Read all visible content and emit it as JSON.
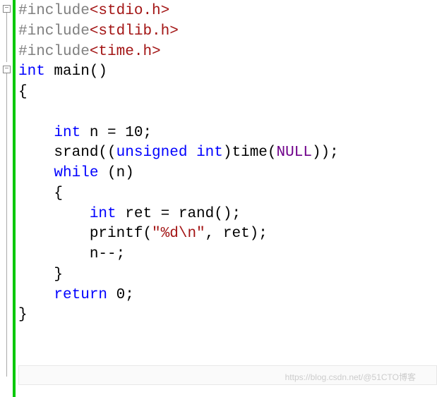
{
  "code": {
    "line1": {
      "preproc": "#include",
      "header": "<stdio.h>"
    },
    "line2": {
      "preproc": "#include",
      "header": "<stdlib.h>"
    },
    "line3": {
      "preproc": "#include",
      "header": "<time.h>"
    },
    "line4": {
      "kw_int": "int",
      "text": " main()"
    },
    "line5": {
      "text": "{"
    },
    "line6": {
      "text": ""
    },
    "line7": {
      "indent": "    ",
      "kw_int": "int",
      "text": " n = 10;"
    },
    "line8": {
      "indent": "    ",
      "text1": "srand((",
      "kw_unsigned": "unsigned",
      "sp": " ",
      "kw_int": "int",
      "text2": ")time(",
      "null": "NULL",
      "text3": "));"
    },
    "line9": {
      "indent": "    ",
      "kw_while": "while",
      "text": " (n)"
    },
    "line10": {
      "indent": "    ",
      "text": "{"
    },
    "line11": {
      "indent": "        ",
      "kw_int": "int",
      "text": " ret = rand();"
    },
    "line12": {
      "indent": "        ",
      "text1": "printf(",
      "string": "\"%d\\n\"",
      "text2": ", ret);"
    },
    "line13": {
      "indent": "        ",
      "text": "n--;"
    },
    "line14": {
      "indent": "    ",
      "text": "}"
    },
    "line15": {
      "indent": "    ",
      "kw_return": "return",
      "text": " 0;"
    },
    "line16": {
      "text": "}"
    }
  },
  "watermark": "https://blog.csdn.net/@51CTO博客"
}
